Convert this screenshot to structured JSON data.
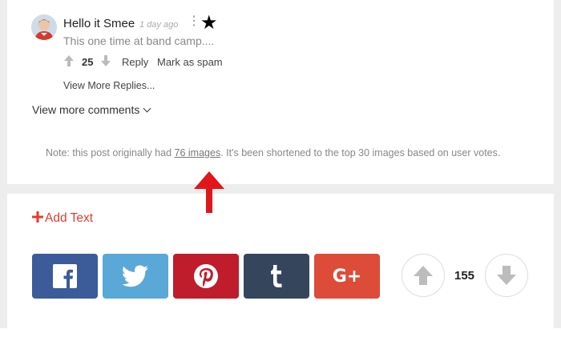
{
  "comment": {
    "author": "Hello it Smee",
    "time": "1 day ago",
    "text": "This one time at band camp....",
    "votes": "25",
    "reply_label": "Reply",
    "spam_label": "Mark as spam",
    "more_replies_label": "View More Replies..."
  },
  "view_more_comments_label": "View more comments",
  "note": {
    "prefix": "Note: this post originally had ",
    "link_text": "76 images",
    "suffix": ". It's been shortened to the top 30 images based on user votes."
  },
  "add_text_label": "Add Text",
  "share_buttons": [
    {
      "name": "facebook",
      "color": "#3b5b99"
    },
    {
      "name": "twitter",
      "color": "#5aa8d8"
    },
    {
      "name": "pinterest",
      "color": "#bf1d2c"
    },
    {
      "name": "tumblr",
      "color": "#35465c"
    },
    {
      "name": "google-plus",
      "color": "#dd4b39",
      "label": "G+"
    }
  ],
  "post_votes": "155",
  "colors": {
    "accent_red": "#e63a2e",
    "annotation_arrow": "#e0161b"
  }
}
